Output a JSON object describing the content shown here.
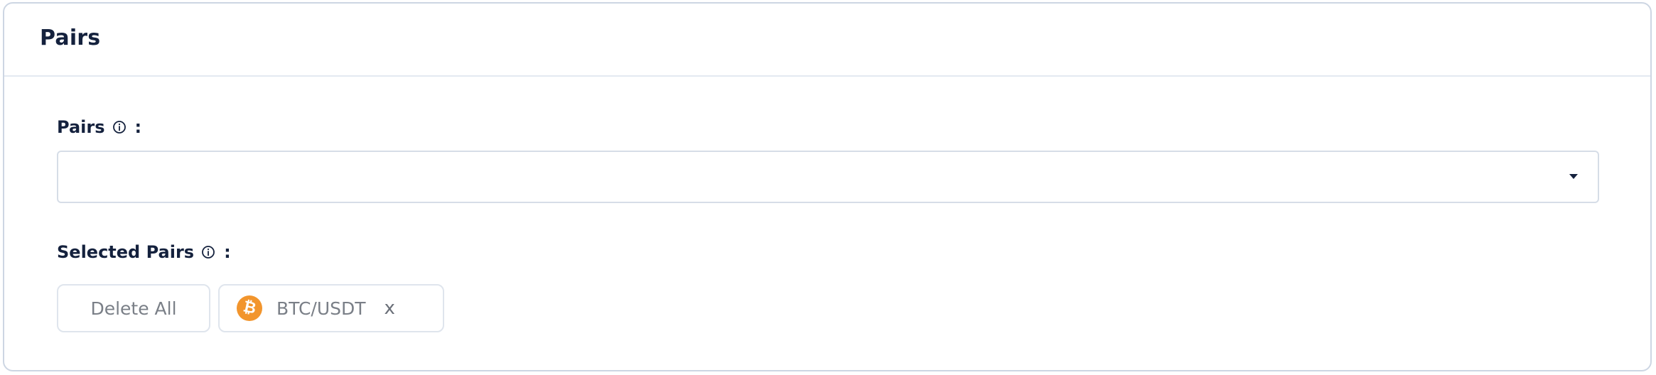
{
  "card": {
    "title": "Pairs"
  },
  "pairs_field": {
    "label": "Pairs",
    "colon": ":",
    "value": ""
  },
  "selected_pairs": {
    "label": "Selected Pairs",
    "colon": ":",
    "delete_all_label": "Delete All",
    "items": [
      {
        "label": "BTC/USDT",
        "icon": "bitcoin-icon",
        "icon_glyph": "₿",
        "remove_label": "x"
      }
    ]
  },
  "colors": {
    "title": "#14213d",
    "border": "#cdd6e3",
    "chip_text": "#7a7f87",
    "bitcoin": "#f2952d"
  }
}
